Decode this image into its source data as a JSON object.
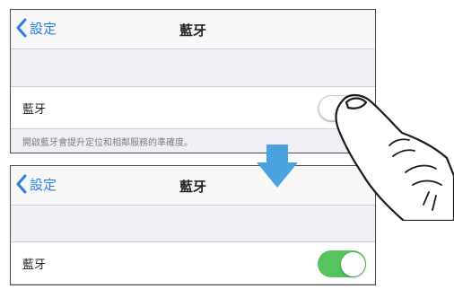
{
  "top_screen": {
    "back_label": "設定",
    "title": "藍牙",
    "cell_label": "藍牙",
    "toggle_state": "off",
    "footer_note": "開啟藍牙會提升定位和相鄰服務的準確度。"
  },
  "bottom_screen": {
    "back_label": "設定",
    "title": "藍牙",
    "cell_label": "藍牙",
    "toggle_state": "on"
  },
  "icons": {
    "back": "chevron-left-icon",
    "transition": "arrow-down-icon",
    "gesture": "hand-tap-icon"
  },
  "colors": {
    "accent_blue": "#2a7de1",
    "toggle_on_green": "#56c45e",
    "arrow_blue": "#4aa3df"
  }
}
